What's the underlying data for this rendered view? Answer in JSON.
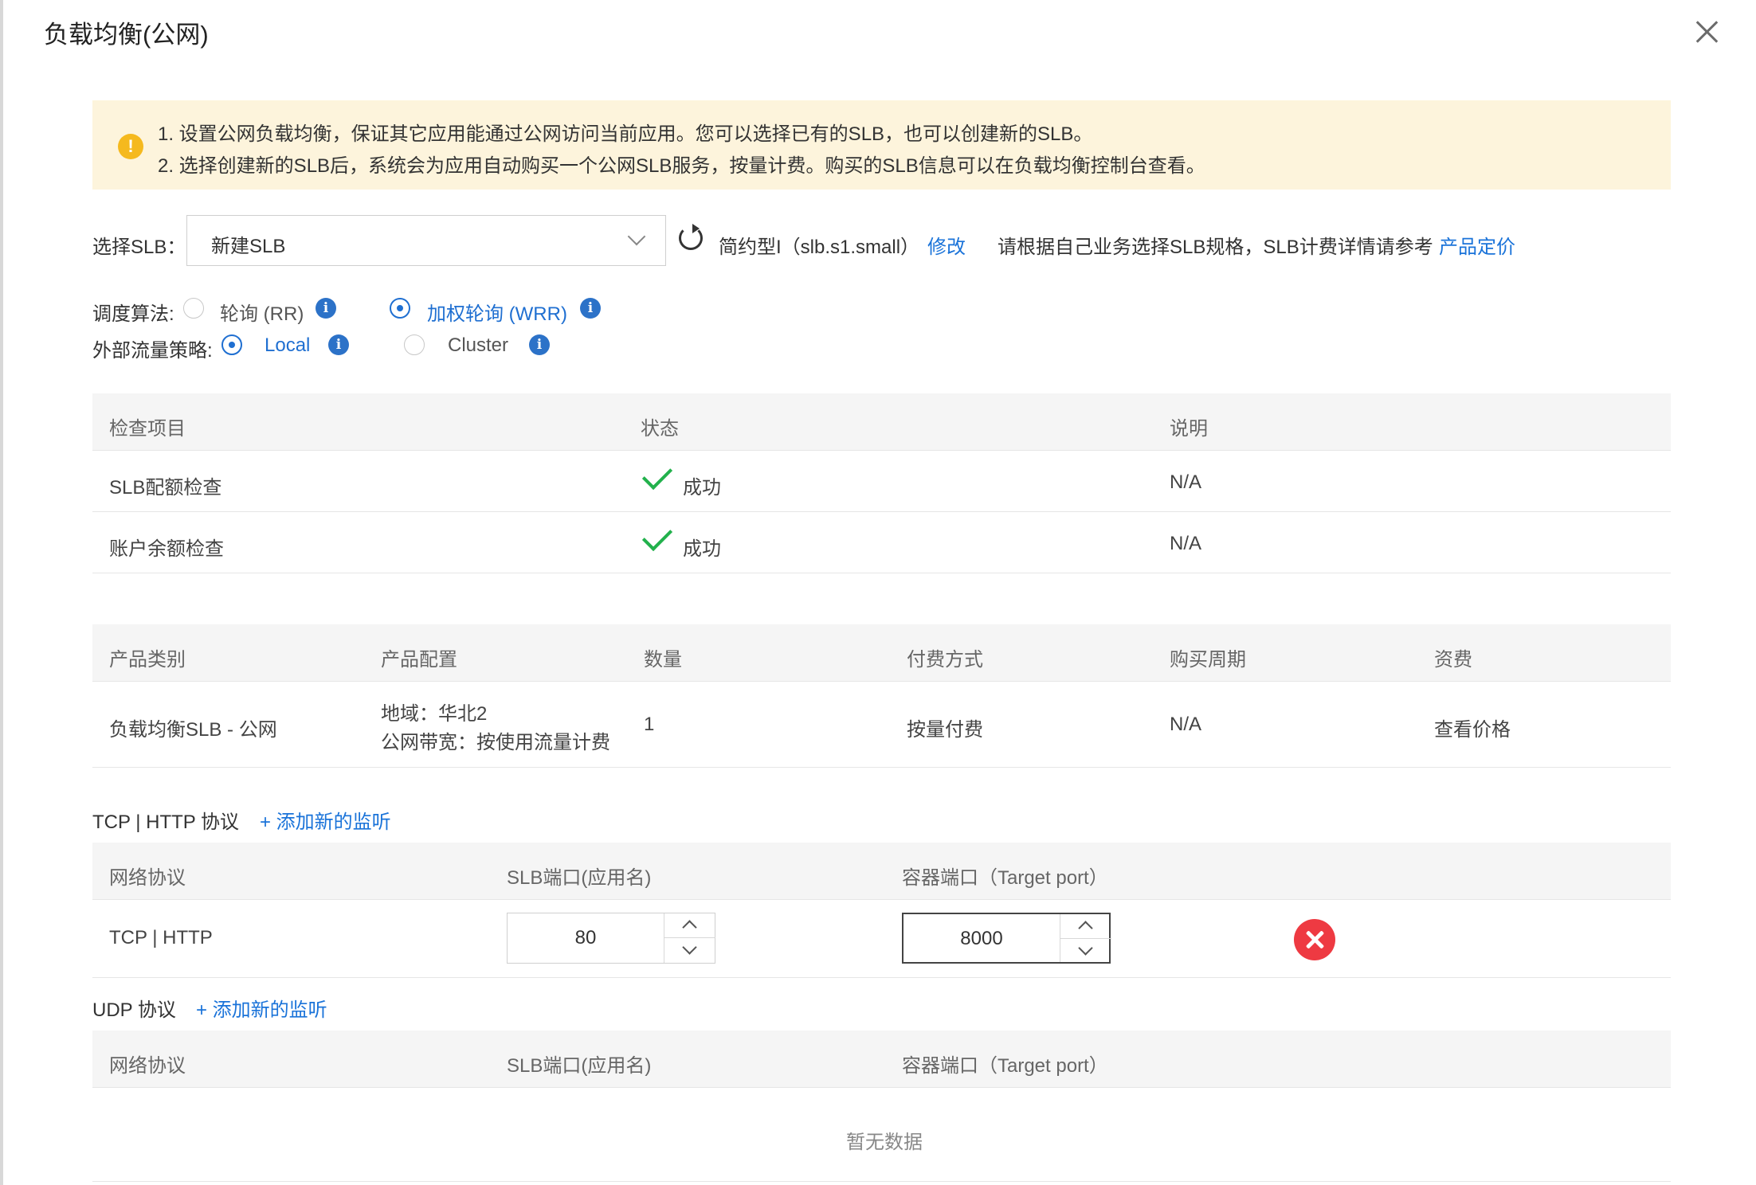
{
  "dialog": {
    "title": "负载均衡(公网)"
  },
  "notice": {
    "line1": "1. 设置公网负载均衡，保证其它应用能通过公网访问当前应用。您可以选择已有的SLB，也可以创建新的SLB。",
    "line2": "2. 选择创建新的SLB后，系统会为应用自动购买一个公网SLB服务，按量计费。购买的SLB信息可以在负载均衡控制台查看。"
  },
  "slb": {
    "label": "选择SLB：",
    "selected": "新建SLB",
    "spec": "简约型I（slb.s1.small）",
    "modify": "修改",
    "hint": "请根据自己业务选择SLB规格，SLB计费详情请参考",
    "pricing_link": "产品定价"
  },
  "scheduling": {
    "label": "调度算法:",
    "options": [
      {
        "label": "轮询 (RR)",
        "selected": false
      },
      {
        "label": "加权轮询 (WRR)",
        "selected": true
      }
    ]
  },
  "traffic_policy": {
    "label": "外部流量策略:",
    "options": [
      {
        "label": "Local",
        "selected": true
      },
      {
        "label": "Cluster",
        "selected": false
      }
    ]
  },
  "check_table": {
    "headers": [
      "检查项目",
      "状态",
      "说明"
    ],
    "rows": [
      {
        "item": "SLB配额检查",
        "status": "成功",
        "note": "N/A"
      },
      {
        "item": "账户余额检查",
        "status": "成功",
        "note": "N/A"
      }
    ]
  },
  "product_table": {
    "headers": [
      "产品类别",
      "产品配置",
      "数量",
      "付费方式",
      "购买周期",
      "资费"
    ],
    "row": {
      "category": "负载均衡SLB - 公网",
      "config_line1": "地域：华北2",
      "config_line2": "公网带宽：按使用流量计费",
      "quantity": "1",
      "payment": "按量付费",
      "period": "N/A",
      "price_link": "查看价格"
    }
  },
  "tcp_section": {
    "title": "TCP | HTTP 协议",
    "add_link": "+ 添加新的监听",
    "headers": [
      "网络协议",
      "SLB端口(应用名)",
      "容器端口（Target port）"
    ],
    "rows": [
      {
        "protocol": "TCP | HTTP",
        "slb_port": "80",
        "target_port": "8000"
      }
    ]
  },
  "udp_section": {
    "title": "UDP 协议",
    "add_link": "+ 添加新的监听",
    "headers": [
      "网络协议",
      "SLB端口(应用名)",
      "容器端口（Target port）"
    ],
    "empty_text": "暂无数据"
  },
  "colors": {
    "accent": "#1a73d9",
    "success": "#22b14c",
    "danger": "#ee3a42",
    "notice_bg": "#fdf4dc",
    "warning": "#f5b91e"
  }
}
